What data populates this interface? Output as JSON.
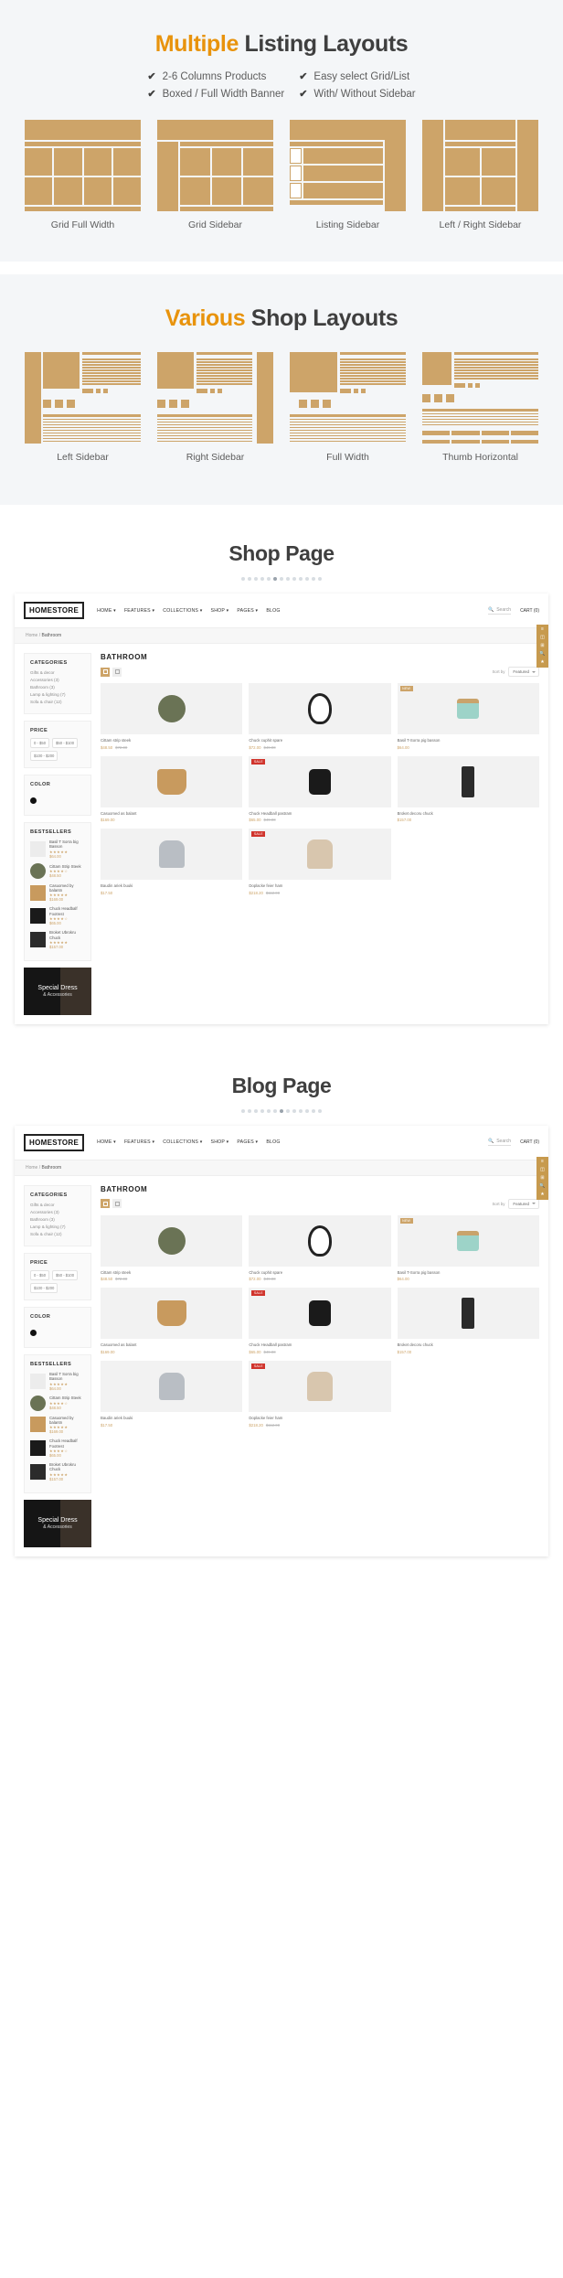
{
  "colors": {
    "accent": "#e8930c",
    "gold": "#cda469",
    "dark": "#3f3f3f"
  },
  "section_listing": {
    "title_highlight": "Multiple",
    "title_rest": " Listing Layouts",
    "features_left": [
      "2-6 Columns Products",
      "Boxed / Full Width Banner"
    ],
    "features_right": [
      "Easy select Grid/List",
      "With/ Without Sidebar"
    ],
    "check_icon": "✔",
    "layouts": [
      {
        "caption": "Grid Full Width"
      },
      {
        "caption": "Grid Sidebar"
      },
      {
        "caption": "Listing Sidebar"
      },
      {
        "caption": "Left / Right Sidebar"
      }
    ]
  },
  "section_shop": {
    "title_highlight": "Various",
    "title_rest": " Shop Layouts",
    "layouts": [
      {
        "caption": "Left Sidebar"
      },
      {
        "caption": "Right Sidebar"
      },
      {
        "caption": "Full Width"
      },
      {
        "caption": "Thumb Horizontal"
      }
    ]
  },
  "shop_page": {
    "title": "Shop Page"
  },
  "blog_page": {
    "title": "Blog Page"
  },
  "browser": {
    "logo": "HOMESTORE",
    "menu": [
      "HOME ▾",
      "FEATURES ▾",
      "COLLECTIONS ▾",
      "SHOP ▾",
      "PAGES ▾",
      "BLOG"
    ],
    "search_placeholder": "Search",
    "cart_label": "CART (0)",
    "breadcrumb_home": "Home",
    "breadcrumb_sep": " / ",
    "breadcrumb_current": "Bathroom",
    "page_heading": "BATHROOM",
    "sort_label": "Sort by",
    "sort_value": "Featured",
    "rail_icons": [
      "≡",
      "◫",
      "⊞",
      "🔍",
      "★"
    ],
    "sidebar": {
      "categories_title": "CATEGORIES",
      "categories": [
        "Gifts & decor",
        "Accessories (3)",
        "Bathroom (3)",
        "Lamp & lighting (7)",
        "Sofa & chair (12)"
      ],
      "price_title": "PRICE",
      "price_options": [
        "0 - $50",
        "$50 - $100",
        "$100 - $200"
      ],
      "color_title": "COLOR",
      "bestsellers_title": "BESTSELLERS",
      "bestsellers": [
        {
          "name": "Basil T Sorra big Basson",
          "stars": "★★★★★",
          "price": "$64.00",
          "old": ""
        },
        {
          "name": "Cittam Strip Steek",
          "stars": "★★★★☆",
          "price": "$48.50",
          "old": "$65.00"
        },
        {
          "name": "Casuomed by balantn",
          "stars": "★★★★★",
          "price": "$169.00",
          "old": ""
        },
        {
          "name": "Chuck Headbalf Footrest",
          "stars": "★★★★☆",
          "price": "$65.00",
          "old": "$49.00"
        },
        {
          "name": "Broket Ubrokru Chuck",
          "stars": "★★★★★",
          "price": "$157.00",
          "old": ""
        }
      ],
      "promo_line1": "Special Dress",
      "promo_line2": "& Accessories"
    },
    "products": [
      {
        "name": "Cittam strip steek",
        "price": "$48.50",
        "old": "$72.00",
        "badge": "",
        "glyph": "g-round"
      },
      {
        "name": "Chuck cuphit spare",
        "price": "$72.00",
        "old": "$49.00",
        "badge": "",
        "glyph": "g-chair-egg"
      },
      {
        "name": "Basil T-Sorra pig basson",
        "price": "$64.00",
        "old": "",
        "badge": "NEW",
        "glyph": "g-jar"
      },
      {
        "name": "Casuomed as balant",
        "price": "$169.00",
        "old": "",
        "badge": "",
        "glyph": "g-woodchair"
      },
      {
        "name": "Chuck Headball pastram",
        "price": "$65.00",
        "old": "$49.00",
        "badge": "SALE",
        "glyph": "g-bag"
      },
      {
        "name": "Broket decoru chuck",
        "price": "$157.00",
        "old": "",
        "badge": "",
        "glyph": "g-bottle"
      },
      {
        "name": "Baudin ariek buuki",
        "price": "$17.50",
        "old": "",
        "badge": "",
        "glyph": "g-greychair"
      },
      {
        "name": "Doplacke feier ham",
        "price": "$218.20",
        "old": "$112.00",
        "badge": "SALE",
        "glyph": "g-office"
      }
    ]
  },
  "pager": {
    "count": 13,
    "active_shop": 6,
    "active_blog": 7
  }
}
